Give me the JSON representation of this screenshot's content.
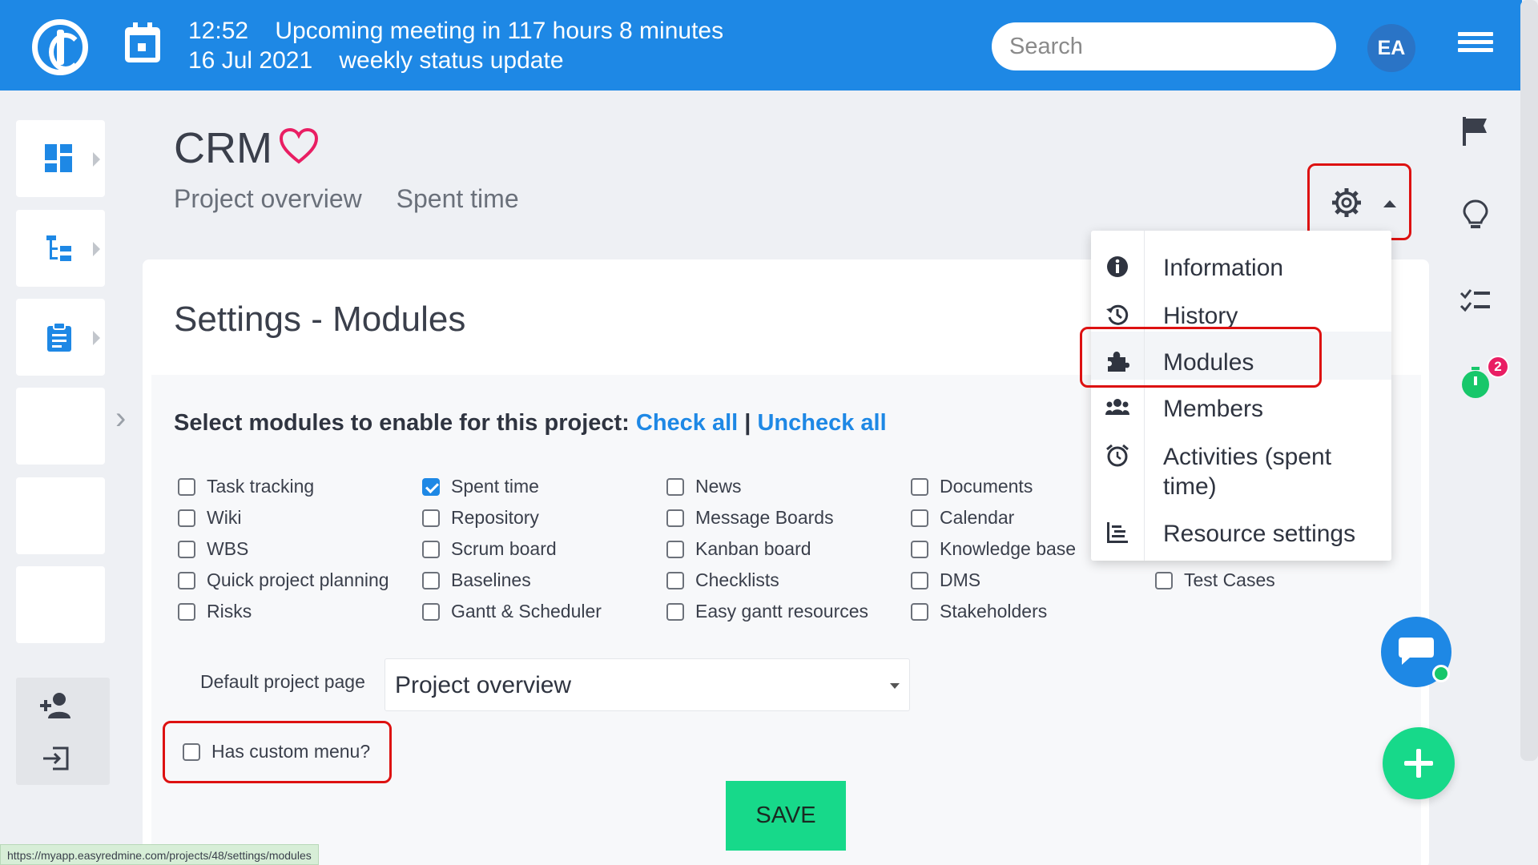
{
  "topbar": {
    "time": "12:52",
    "meeting_text": "Upcoming meeting in 117 hours 8 minutes",
    "date": "16 Jul 2021",
    "meeting_name": "weekly status update",
    "search_placeholder": "Search",
    "avatar_initials": "EA",
    "accent": "#1e88e5"
  },
  "project": {
    "title": "CRM",
    "links": [
      "Project overview",
      "Spent time"
    ]
  },
  "settings": {
    "title": "Settings - Modules",
    "select_label": "Select modules to enable for this project:",
    "check_all": "Check all",
    "separator": "|",
    "uncheck_all": "Uncheck all",
    "modules": [
      {
        "label": "Task tracking",
        "checked": false
      },
      {
        "label": "Spent time",
        "checked": true
      },
      {
        "label": "News",
        "checked": false
      },
      {
        "label": "Documents",
        "checked": false
      },
      {
        "label": "Wiki",
        "checked": false
      },
      {
        "label": "Repository",
        "checked": false
      },
      {
        "label": "Message Boards",
        "checked": false
      },
      {
        "label": "Calendar",
        "checked": false
      },
      {
        "label": "WBS",
        "checked": false
      },
      {
        "label": "Scrum board",
        "checked": false
      },
      {
        "label": "Kanban board",
        "checked": false
      },
      {
        "label": "Knowledge base",
        "checked": false
      },
      {
        "label": "Quick project planning",
        "checked": false
      },
      {
        "label": "Baselines",
        "checked": false
      },
      {
        "label": "Checklists",
        "checked": false
      },
      {
        "label": "DMS",
        "checked": false
      },
      {
        "label": "Test Cases",
        "checked": false
      },
      {
        "label": "Risks",
        "checked": false
      },
      {
        "label": "Gantt & Scheduler",
        "checked": false
      },
      {
        "label": "Easy gantt resources",
        "checked": false
      },
      {
        "label": "Stakeholders",
        "checked": false
      }
    ],
    "default_page_label": "Default project page",
    "default_page_value": "Project overview",
    "custom_menu_label": "Has custom menu?",
    "save_label": "SAVE"
  },
  "dropdown": {
    "items": [
      {
        "label": "Information",
        "icon": "info-icon"
      },
      {
        "label": "History",
        "icon": "history-icon"
      },
      {
        "label": "Modules",
        "icon": "puzzle-icon",
        "active": true
      },
      {
        "label": "Members",
        "icon": "members-icon"
      },
      {
        "label": "Activities (spent time)",
        "icon": "alarm-icon"
      },
      {
        "label": "Resource settings",
        "icon": "resource-icon"
      }
    ]
  },
  "sidebar": {
    "timer_badge": "2"
  },
  "statusbar": {
    "url": "https://myapp.easyredmine.com/projects/48/settings/modules"
  }
}
